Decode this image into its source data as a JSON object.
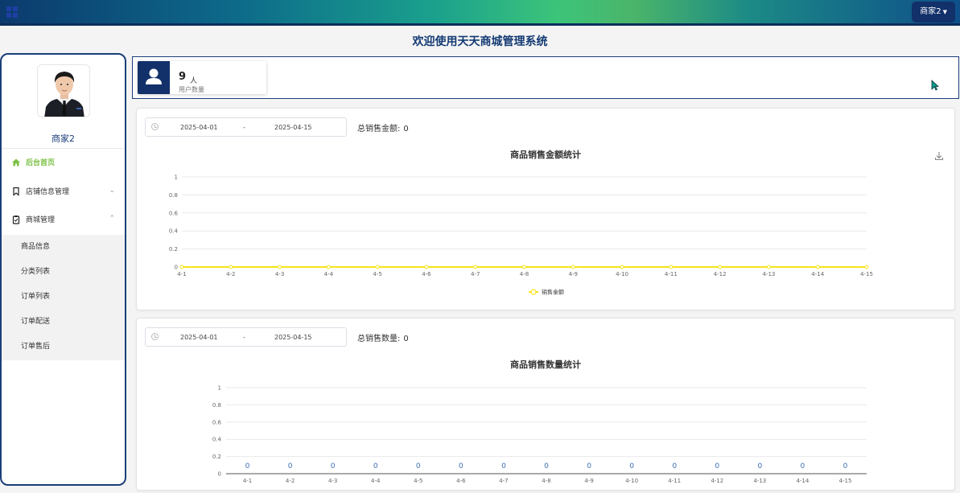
{
  "header": {
    "user_menu_label": "商家2",
    "icons": {
      "app": "grid-icon",
      "menu_arrow": "chevron-down-icon"
    }
  },
  "page_title": "欢迎使用天天商城管理系统",
  "sidebar": {
    "shop_name": "商家2",
    "avatar_icon": "avatar",
    "menu": [
      {
        "label": "后台首页",
        "icon": "home-icon",
        "active": true
      },
      {
        "label": "店铺信息管理",
        "icon": "bookmark-icon",
        "arrow": "chevron-down-icon"
      },
      {
        "label": "商城管理",
        "icon": "clipboard-icon",
        "arrow": "chevron-up-icon",
        "expanded": true
      }
    ],
    "submenu": [
      {
        "label": "商品信息"
      },
      {
        "label": "分类列表"
      },
      {
        "label": "订单列表"
      },
      {
        "label": "订单配送"
      },
      {
        "label": "订单售后"
      }
    ],
    "accent_color": "#7bc145"
  },
  "stats": {
    "user_count": "9",
    "user_unit": "人",
    "user_label": "用户数量",
    "icon": "user-icon"
  },
  "panel1": {
    "date_start": "2025-04-01",
    "date_sep": "-",
    "date_end": "2025-04-15",
    "total_label": "总销售金额:",
    "total_value": "0",
    "icon": "download-icon"
  },
  "panel2": {
    "date_start": "2025-04-01",
    "date_sep": "-",
    "date_end": "2025-04-15",
    "total_label": "总销售数量:",
    "total_value": "0"
  },
  "chart_data": [
    {
      "type": "line",
      "title": "商品销售金额统计",
      "categories": [
        "4-1",
        "4-2",
        "4-3",
        "4-4",
        "4-5",
        "4-6",
        "4-7",
        "4-8",
        "4-9",
        "4-10",
        "4-11",
        "4-12",
        "4-13",
        "4-14",
        "4-15"
      ],
      "series": [
        {
          "name": "销售金额",
          "values": [
            0,
            0,
            0,
            0,
            0,
            0,
            0,
            0,
            0,
            0,
            0,
            0,
            0,
            0,
            0
          ],
          "color": "#f5e51b"
        }
      ],
      "yticks": [
        "0",
        "0.2",
        "0.4",
        "0.6",
        "0.8",
        "1"
      ],
      "ylim": [
        0,
        1
      ],
      "legend": "bottom-center"
    },
    {
      "type": "bar",
      "title": "商品销售数量统计",
      "categories": [
        "4-1",
        "4-2",
        "4-3",
        "4-4",
        "4-5",
        "4-6",
        "4-7",
        "4-8",
        "4-9",
        "4-10",
        "4-11",
        "4-12",
        "4-13",
        "4-14",
        "4-15"
      ],
      "series": [
        {
          "values": [
            0,
            0,
            0,
            0,
            0,
            0,
            0,
            0,
            0,
            0,
            0,
            0,
            0,
            0,
            0
          ],
          "color": "#3c6db5"
        }
      ],
      "data_labels": [
        "0",
        "0",
        "0",
        "0",
        "0",
        "0",
        "0",
        "0",
        "0",
        "0",
        "0",
        "0",
        "0",
        "0",
        "0"
      ],
      "yticks": [
        "0",
        "0.2",
        "0.4",
        "0.6",
        "0.8",
        "1"
      ],
      "ylim": [
        0,
        1
      ]
    }
  ],
  "colors": {
    "primary": "#12306a",
    "title": "#133a73",
    "line": "#f5e51b",
    "bar_label": "#3c6db5"
  }
}
